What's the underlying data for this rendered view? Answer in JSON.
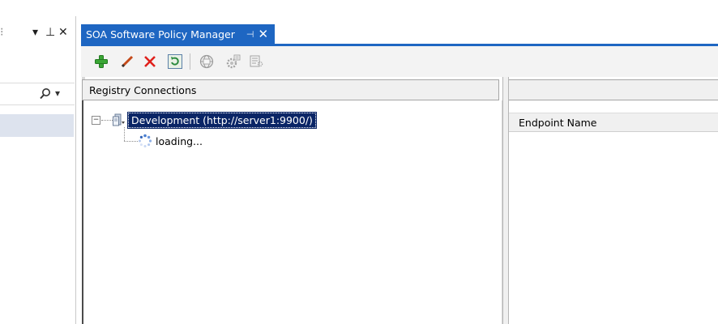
{
  "left_panel": {
    "title_glyphs": {
      "dropdown": "▾",
      "pin": "⊥",
      "close": "✕"
    },
    "search_glyph": "⌕",
    "search_dropdown": "▾"
  },
  "document_tab": {
    "title": "SOA Software Policy Manager",
    "pin_glyph": "⊣",
    "close_glyph": "✕",
    "accent": "#1e66c2"
  },
  "toolbar": {
    "buttons": [
      {
        "name": "add-icon",
        "color": "#3aa635"
      },
      {
        "name": "edit-pencil-icon",
        "color": "#c44a1a"
      },
      {
        "name": "delete-x-icon",
        "color": "#e0201b"
      },
      {
        "name": "refresh-icon",
        "color": "#2b8a3e"
      },
      {
        "name": "globe-publish-icon",
        "color": "#9a9a9a"
      },
      {
        "name": "gear-settings-icon",
        "color": "#9a9a9a"
      },
      {
        "name": "policy-doc-icon",
        "color": "#9a9a9a"
      }
    ]
  },
  "registry": {
    "header": "Registry Connections",
    "root": {
      "expander": "−",
      "label": "Development (http://server1:9900/)"
    },
    "child": {
      "label": "loading..."
    },
    "selection_color": "#0a2566"
  },
  "endpoint": {
    "column_header": "Endpoint Name"
  }
}
